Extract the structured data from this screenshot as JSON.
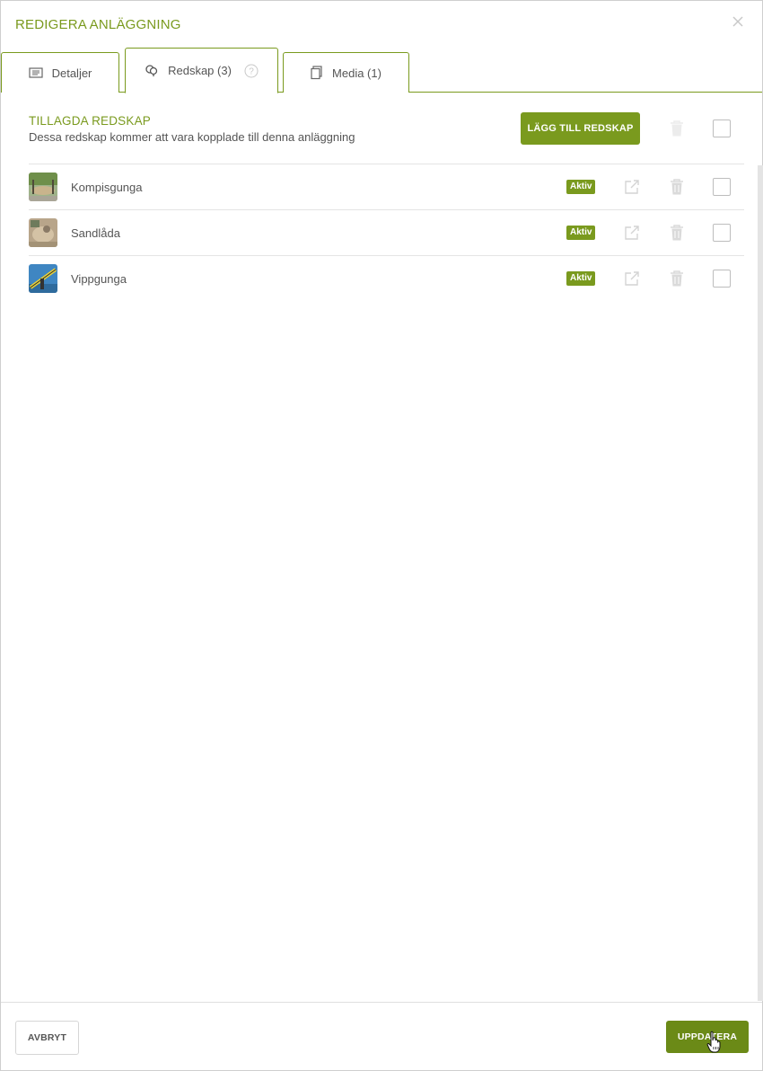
{
  "modal": {
    "title": "REDIGERA ANLÄGGNING"
  },
  "tabs": [
    {
      "label": "Detaljer",
      "icon": "list-icon"
    },
    {
      "label": "Redskap (3)",
      "icon": "equipment-icon",
      "active": true
    },
    {
      "label": "Media (1)",
      "icon": "copy-icon"
    }
  ],
  "section": {
    "title": "TILLAGDA REDSKAP",
    "subtitle": "Dessa redskap kommer att vara kopplade till denna anläggning",
    "add_button": "LÄGG TILL REDSKAP"
  },
  "equipment": [
    {
      "name": "Kompisgunga",
      "status": "Aktiv"
    },
    {
      "name": "Sandlåda",
      "status": "Aktiv"
    },
    {
      "name": "Vippgunga",
      "status": "Aktiv"
    }
  ],
  "footer": {
    "cancel_label": "AVBRYT",
    "update_label": "UPPDATERA"
  },
  "colors": {
    "accent": "#7a9a1e",
    "accent_dark": "#6b8a17",
    "divider": "#e4e4e4"
  }
}
